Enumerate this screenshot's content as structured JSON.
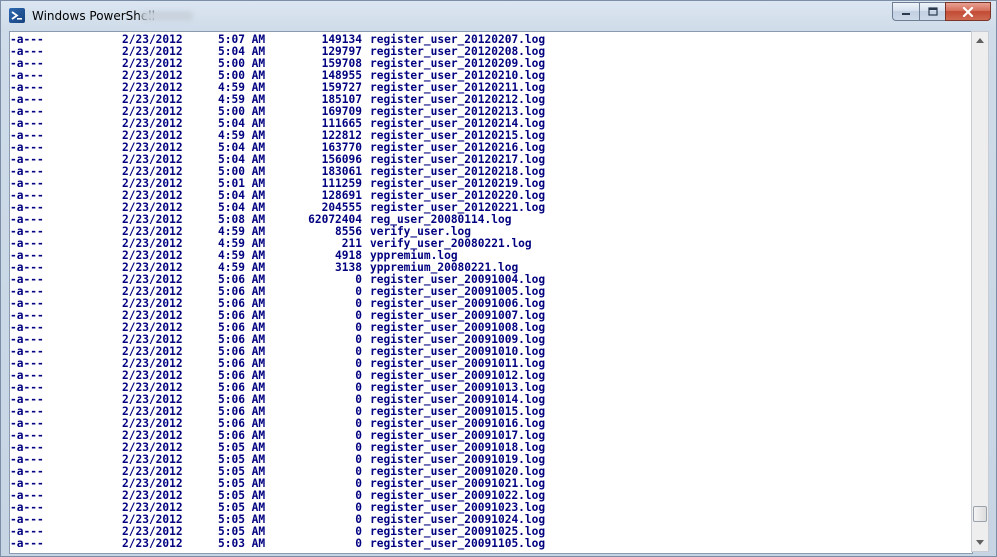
{
  "window": {
    "title": "Windows PowerShell",
    "icon": "powershell-icon",
    "controls": [
      "minimize-icon",
      "maximize-icon",
      "close-icon"
    ]
  },
  "console": {
    "foreground": "#000080",
    "background": "#ffffff",
    "rows": [
      {
        "mode": "-a---",
        "date": "2/23/2012",
        "time": "5:07 AM",
        "length": "149134",
        "name": "register_user_20120207.log"
      },
      {
        "mode": "-a---",
        "date": "2/23/2012",
        "time": "5:04 AM",
        "length": "129797",
        "name": "register_user_20120208.log"
      },
      {
        "mode": "-a---",
        "date": "2/23/2012",
        "time": "5:00 AM",
        "length": "159708",
        "name": "register_user_20120209.log"
      },
      {
        "mode": "-a---",
        "date": "2/23/2012",
        "time": "5:00 AM",
        "length": "148955",
        "name": "register_user_20120210.log"
      },
      {
        "mode": "-a---",
        "date": "2/23/2012",
        "time": "4:59 AM",
        "length": "159727",
        "name": "register_user_20120211.log"
      },
      {
        "mode": "-a---",
        "date": "2/23/2012",
        "time": "4:59 AM",
        "length": "185107",
        "name": "register_user_20120212.log"
      },
      {
        "mode": "-a---",
        "date": "2/23/2012",
        "time": "5:00 AM",
        "length": "169709",
        "name": "register_user_20120213.log"
      },
      {
        "mode": "-a---",
        "date": "2/23/2012",
        "time": "5:04 AM",
        "length": "111665",
        "name": "register_user_20120214.log"
      },
      {
        "mode": "-a---",
        "date": "2/23/2012",
        "time": "4:59 AM",
        "length": "122812",
        "name": "register_user_20120215.log"
      },
      {
        "mode": "-a---",
        "date": "2/23/2012",
        "time": "5:04 AM",
        "length": "163770",
        "name": "register_user_20120216.log"
      },
      {
        "mode": "-a---",
        "date": "2/23/2012",
        "time": "5:04 AM",
        "length": "156096",
        "name": "register_user_20120217.log"
      },
      {
        "mode": "-a---",
        "date": "2/23/2012",
        "time": "5:00 AM",
        "length": "183061",
        "name": "register_user_20120218.log"
      },
      {
        "mode": "-a---",
        "date": "2/23/2012",
        "time": "5:01 AM",
        "length": "111259",
        "name": "register_user_20120219.log"
      },
      {
        "mode": "-a---",
        "date": "2/23/2012",
        "time": "5:04 AM",
        "length": "128691",
        "name": "register_user_20120220.log"
      },
      {
        "mode": "-a---",
        "date": "2/23/2012",
        "time": "5:04 AM",
        "length": "204555",
        "name": "register_user_20120221.log"
      },
      {
        "mode": "-a---",
        "date": "2/23/2012",
        "time": "5:08 AM",
        "length": "62072404",
        "name": "reg_user_20080114.log"
      },
      {
        "mode": "-a---",
        "date": "2/23/2012",
        "time": "4:59 AM",
        "length": "8556",
        "name": "verify_user.log"
      },
      {
        "mode": "-a---",
        "date": "2/23/2012",
        "time": "4:59 AM",
        "length": "211",
        "name": "verify_user_20080221.log"
      },
      {
        "mode": "-a---",
        "date": "2/23/2012",
        "time": "4:59 AM",
        "length": "4918",
        "name": "yppremium.log"
      },
      {
        "mode": "-a---",
        "date": "2/23/2012",
        "time": "4:59 AM",
        "length": "3138",
        "name": "yppremium_20080221.log"
      },
      {
        "mode": "-a---",
        "date": "2/23/2012",
        "time": "5:06 AM",
        "length": "0",
        "name": "register_user_20091004.log"
      },
      {
        "mode": "-a---",
        "date": "2/23/2012",
        "time": "5:06 AM",
        "length": "0",
        "name": "register_user_20091005.log"
      },
      {
        "mode": "-a---",
        "date": "2/23/2012",
        "time": "5:06 AM",
        "length": "0",
        "name": "register_user_20091006.log"
      },
      {
        "mode": "-a---",
        "date": "2/23/2012",
        "time": "5:06 AM",
        "length": "0",
        "name": "register_user_20091007.log"
      },
      {
        "mode": "-a---",
        "date": "2/23/2012",
        "time": "5:06 AM",
        "length": "0",
        "name": "register_user_20091008.log"
      },
      {
        "mode": "-a---",
        "date": "2/23/2012",
        "time": "5:06 AM",
        "length": "0",
        "name": "register_user_20091009.log"
      },
      {
        "mode": "-a---",
        "date": "2/23/2012",
        "time": "5:06 AM",
        "length": "0",
        "name": "register_user_20091010.log"
      },
      {
        "mode": "-a---",
        "date": "2/23/2012",
        "time": "5:06 AM",
        "length": "0",
        "name": "register_user_20091011.log"
      },
      {
        "mode": "-a---",
        "date": "2/23/2012",
        "time": "5:06 AM",
        "length": "0",
        "name": "register_user_20091012.log"
      },
      {
        "mode": "-a---",
        "date": "2/23/2012",
        "time": "5:06 AM",
        "length": "0",
        "name": "register_user_20091013.log"
      },
      {
        "mode": "-a---",
        "date": "2/23/2012",
        "time": "5:06 AM",
        "length": "0",
        "name": "register_user_20091014.log"
      },
      {
        "mode": "-a---",
        "date": "2/23/2012",
        "time": "5:06 AM",
        "length": "0",
        "name": "register_user_20091015.log"
      },
      {
        "mode": "-a---",
        "date": "2/23/2012",
        "time": "5:06 AM",
        "length": "0",
        "name": "register_user_20091016.log"
      },
      {
        "mode": "-a---",
        "date": "2/23/2012",
        "time": "5:06 AM",
        "length": "0",
        "name": "register_user_20091017.log"
      },
      {
        "mode": "-a---",
        "date": "2/23/2012",
        "time": "5:05 AM",
        "length": "0",
        "name": "register_user_20091018.log"
      },
      {
        "mode": "-a---",
        "date": "2/23/2012",
        "time": "5:05 AM",
        "length": "0",
        "name": "register_user_20091019.log"
      },
      {
        "mode": "-a---",
        "date": "2/23/2012",
        "time": "5:05 AM",
        "length": "0",
        "name": "register_user_20091020.log"
      },
      {
        "mode": "-a---",
        "date": "2/23/2012",
        "time": "5:05 AM",
        "length": "0",
        "name": "register_user_20091021.log"
      },
      {
        "mode": "-a---",
        "date": "2/23/2012",
        "time": "5:05 AM",
        "length": "0",
        "name": "register_user_20091022.log"
      },
      {
        "mode": "-a---",
        "date": "2/23/2012",
        "time": "5:05 AM",
        "length": "0",
        "name": "register_user_20091023.log"
      },
      {
        "mode": "-a---",
        "date": "2/23/2012",
        "time": "5:05 AM",
        "length": "0",
        "name": "register_user_20091024.log"
      },
      {
        "mode": "-a---",
        "date": "2/23/2012",
        "time": "5:05 AM",
        "length": "0",
        "name": "register_user_20091025.log"
      },
      {
        "mode": "-a---",
        "date": "2/23/2012",
        "time": "5:03 AM",
        "length": "0",
        "name": "register_user_20091105.log"
      }
    ]
  },
  "scrollbar": {
    "position": 0.97
  }
}
